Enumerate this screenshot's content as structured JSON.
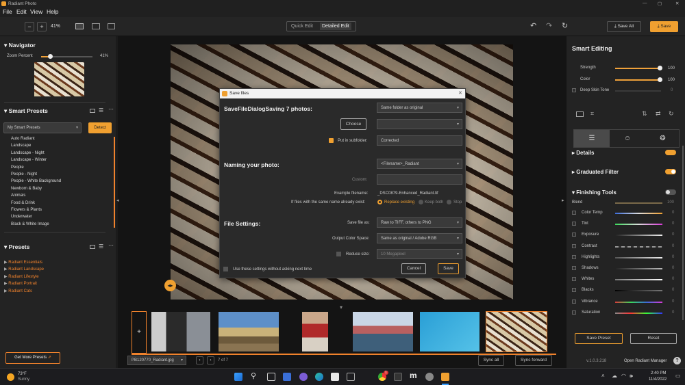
{
  "app": {
    "title": "Radiant Photo"
  },
  "window_controls": [
    "—",
    "▢",
    "✕"
  ],
  "menu": [
    "File",
    "Edit",
    "View",
    "Help"
  ],
  "toolbar": {
    "zoom_out": "−",
    "zoom_in": "+",
    "zoom": "41%",
    "quick_edit": "Quick Edit",
    "detailed_edit": "Detailed Edit",
    "save_all": "Save All",
    "save": "Save"
  },
  "navigator": {
    "title": "Navigator",
    "zoom_label": "Zoom Percent",
    "zoom_value": "41%",
    "zoom_level": 0.41
  },
  "smart_presets": {
    "title": "Smart Presets",
    "selected": "My Smart Presets",
    "detect": "Detect",
    "items": [
      "Auto Radiant",
      "Landscape",
      "Landscape - Night",
      "Landscape - Winter",
      "People",
      "People - Night",
      "People - White Background",
      "Newborn & Baby",
      "Animals",
      "Food & Drink",
      "Flowers & Plants",
      "Underwater",
      "Black & White Image"
    ]
  },
  "presets": {
    "title": "Presets",
    "items": [
      "Radiant Essentials",
      "Radiant Landscape",
      "Radiant Lifestyle",
      "Radiant Portrait",
      "Radiant Cats"
    ]
  },
  "get_more": "Get More Presets",
  "dialog": {
    "title": "Save files",
    "saving": "SaveFileDialogSaving 7 photos:",
    "folder": "Same folder as original",
    "choose": "Choose",
    "path": "",
    "subfolder_label": "Put in subfolder:",
    "subfolder": "Corrected",
    "naming_title": "Naming your photo:",
    "naming": "<Filename>_Radiant",
    "custom_label": "Custom:",
    "custom": "",
    "example_label": "Example filename:",
    "example": "_DSC0879-Enhanced_Radiant.tif",
    "exists_label": "If files with the same name already exist:",
    "opt_replace": "Replace existing",
    "opt_keep": "Keep both",
    "opt_stop": "Stop",
    "settings_title": "File Settings:",
    "saveas_label": "Save file as:",
    "saveas": "Raw to TIFF, others to PNG",
    "colorspace_label": "Output Color Space:",
    "colorspace": "Same as original / Adobe RGB",
    "reduce_label": "Reduce size:",
    "reduce": "10 Megapixel",
    "remember": "Use these settings without asking next time",
    "cancel": "Cancel",
    "save": "Save"
  },
  "filmstrip": {
    "add": "+",
    "filename": "PB120770_Radiant.jpg",
    "prev": "‹",
    "next": "›",
    "count": "7 of 7",
    "sync_all": "Sync all",
    "sync_forward": "Sync forward"
  },
  "smart_editing": {
    "title": "Smart Editing",
    "strength_label": "Strength",
    "strength": "100",
    "color_label": "Color",
    "color": "100",
    "deep_label": "Deep Skin Tone",
    "deep": "0"
  },
  "sections": {
    "details": "Details",
    "graduated": "Graduated Filter",
    "finishing": "Finishing Tools"
  },
  "finishing": {
    "blend_label": "Blend",
    "blend": "100",
    "items": [
      {
        "label": "Color Temp",
        "value": "0"
      },
      {
        "label": "Tint",
        "value": "0"
      },
      {
        "label": "Exposure",
        "value": "0"
      },
      {
        "label": "Contrast",
        "value": "0"
      },
      {
        "label": "Highlights",
        "value": "0"
      },
      {
        "label": "Shadows",
        "value": "0"
      },
      {
        "label": "Whites",
        "value": "0"
      },
      {
        "label": "Blacks",
        "value": "0"
      },
      {
        "label": "Vibrance",
        "value": "0"
      },
      {
        "label": "Saturation",
        "value": "0"
      }
    ]
  },
  "footer": {
    "save_preset": "Save Preset",
    "reset": "Reset",
    "version": "v.1.0.3.218",
    "open_manager": "Open Radiant Manager",
    "help": "?"
  },
  "taskbar": {
    "temp": "73°F",
    "weather": "Sunny",
    "time": "2:40 PM",
    "date": "11/4/2022",
    "chat_badge": "1"
  },
  "colors": {
    "accent": "#f0822c",
    "bg": "#1b1b1b"
  }
}
